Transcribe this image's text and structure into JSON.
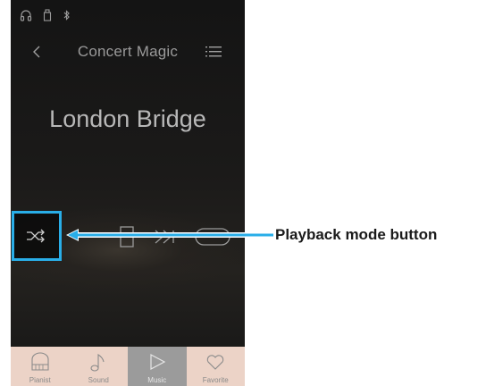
{
  "nav": {
    "title": "Concert Magic"
  },
  "song": {
    "title": "London Bridge"
  },
  "tabs": [
    {
      "label": "Pianist",
      "icon": "piano-icon"
    },
    {
      "label": "Sound",
      "icon": "music-note-icon"
    },
    {
      "label": "Music",
      "icon": "play-icon",
      "active": true
    },
    {
      "label": "Favorite",
      "icon": "heart-icon"
    }
  ],
  "callout": {
    "label": "Playback mode button"
  },
  "colors": {
    "highlight": "#29aee8",
    "tab_bg": "#ecd3c7",
    "tab_active": "#9b9b9b"
  }
}
